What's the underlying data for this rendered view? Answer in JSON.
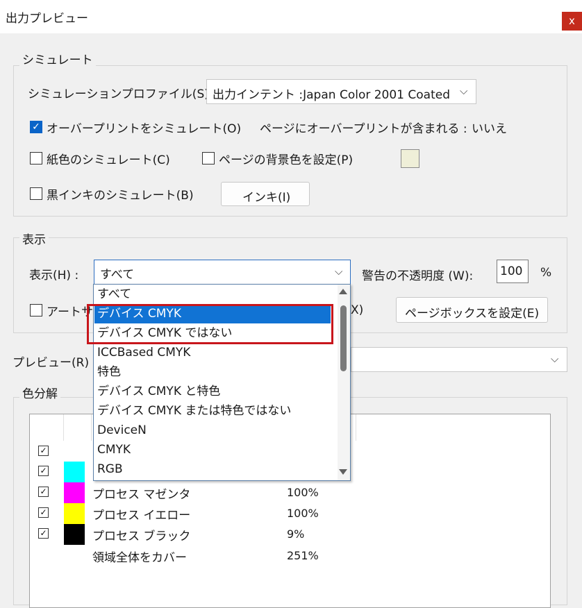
{
  "window": {
    "title": "出力プレビュー",
    "close_label": "x"
  },
  "simulate": {
    "group_label": "シミュレート",
    "profile_label": "シミュレーションプロファイル(S) :",
    "profile_value": "出力インテント :Japan Color 2001 Coated",
    "overprint_label": "オーバープリントをシミュレート(O)",
    "overprint_checked": true,
    "overprint_info_label": "ページにオーバープリントが含まれる :",
    "overprint_info_value": "いいえ",
    "paper_color_label": "紙色のシミュレート(C)",
    "bg_color_label": "ページの背景色を設定(P)",
    "bg_color": "#efefd8",
    "black_ink_label": "黒インキのシミュレート(B)",
    "ink_button": "インキ(I)"
  },
  "display": {
    "group_label": "表示",
    "show_label": "表示(H) :",
    "show_value": "すべて",
    "warning_label": "警告の不透明度 (W):",
    "warning_value": "100",
    "warning_unit": "%",
    "art_label": "アートサ",
    "art_tail": "X)",
    "pagebox_button": "ページボックスを設定(E)"
  },
  "dropdown": {
    "options": [
      "すべて",
      "デバイス CMYK",
      "デバイス CMYK ではない",
      "ICCBased CMYK",
      "特色",
      "デバイス CMYK と特色",
      "デバイス CMYK または特色ではない",
      "DeviceN",
      "CMYK",
      "RGB"
    ],
    "selected_index": 1
  },
  "preview": {
    "label": "プレビュー(R) :"
  },
  "separations": {
    "group_label": "色分解",
    "rows": [
      {
        "name": "",
        "value": "",
        "checked": true,
        "color": ""
      },
      {
        "name": "",
        "value": "",
        "checked": true,
        "color": "#00ffff"
      },
      {
        "name": "プロセス マゼンタ",
        "value": "100%",
        "checked": true,
        "color": "#ff00ff"
      },
      {
        "name": "プロセス イエロー",
        "value": "100%",
        "checked": true,
        "color": "#ffff00"
      },
      {
        "name": "プロセス ブラック",
        "value": "9%",
        "checked": true,
        "color": "#000000"
      },
      {
        "name": "領域全体をカバー",
        "value": "251%",
        "checked": false,
        "color": ""
      }
    ]
  }
}
